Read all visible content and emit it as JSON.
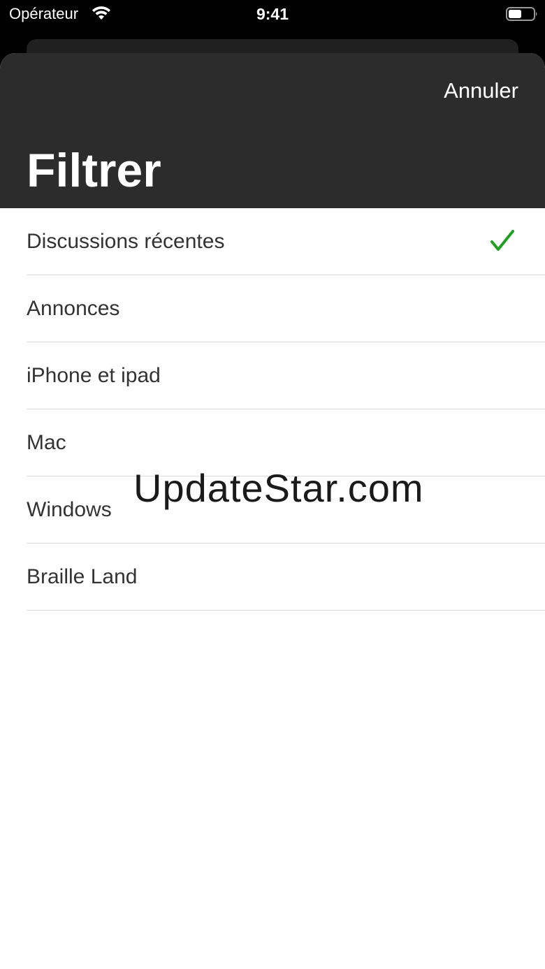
{
  "status_bar": {
    "carrier": "Opérateur",
    "time": "9:41"
  },
  "header": {
    "cancel_label": "Annuler",
    "title": "Filtrer"
  },
  "filters": [
    {
      "label": "Discussions récentes",
      "selected": true
    },
    {
      "label": "Annonces",
      "selected": false
    },
    {
      "label": "iPhone et ipad",
      "selected": false
    },
    {
      "label": "Mac",
      "selected": false
    },
    {
      "label": "Windows",
      "selected": false
    },
    {
      "label": "Braille Land",
      "selected": false
    }
  ],
  "watermark": "UpdateStar.com",
  "colors": {
    "header_bg": "#2c2c2c",
    "check": "#1f9e1f"
  }
}
